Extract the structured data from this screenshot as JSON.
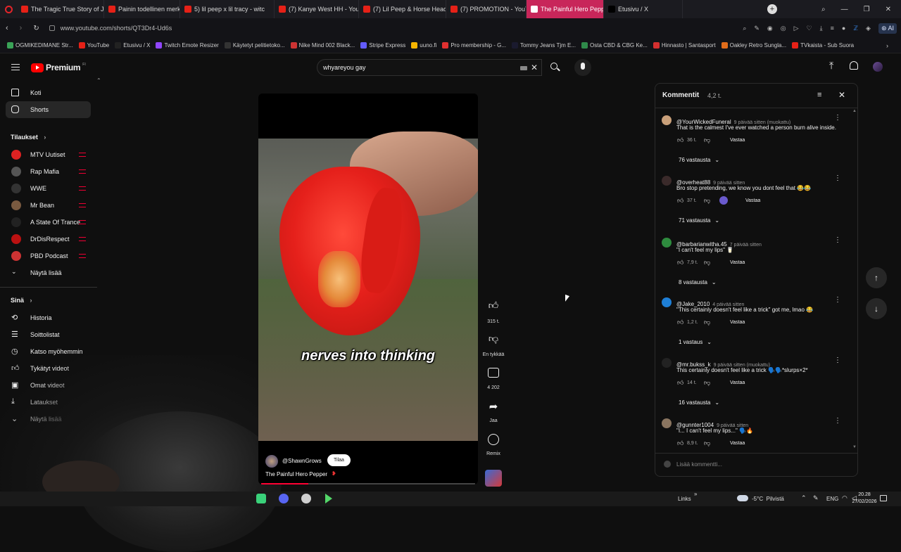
{
  "browser": {
    "tabs": [
      {
        "label": "The Tragic True Story of Ju",
        "color": "#e62117"
      },
      {
        "label": "Painin todellinen merkity",
        "color": "#e62117"
      },
      {
        "label": "5) lil peep x lil tracy - witc",
        "color": "#e62117"
      },
      {
        "label": "(7) Kanye West HH - YouT",
        "color": "#e62117"
      },
      {
        "label": "(7) Lil Peep & Horse Head",
        "color": "#e62117"
      },
      {
        "label": "(7) PROMOTION - YouTub",
        "color": "#e62117"
      },
      {
        "label": "The Painful Hero Pepp",
        "color": "#ffffff"
      },
      {
        "label": "Etusivu / X",
        "color": "#000000"
      }
    ],
    "url": "www.youtube.com/shorts/QT3Dr4-Ud6s",
    "addr_right_label": "AI",
    "bookmarks": [
      {
        "label": "OGMIKEDIMANE Str...",
        "color": "#3aa357"
      },
      {
        "label": "YouTube",
        "color": "#e62117"
      },
      {
        "label": "Etusivu / X",
        "color": "#222222"
      },
      {
        "label": "Twitch Emote Resizer",
        "color": "#9146ff"
      },
      {
        "label": "Käytetyt pelitietoko...",
        "color": "#333333"
      },
      {
        "label": "Nike Mind 002 Black...",
        "color": "#cc3333"
      },
      {
        "label": "Stripe Express",
        "color": "#635bff"
      },
      {
        "label": "uuno.fi",
        "color": "#f5b400"
      },
      {
        "label": "Pro membership - G...",
        "color": "#e03030"
      },
      {
        "label": "Tommy Jeans Tjm E...",
        "color": "#1a1a2e"
      },
      {
        "label": "Osta CBD & CBG Ke...",
        "color": "#2f8a4a"
      },
      {
        "label": "Hinnasto | Santasport",
        "color": "#d32f2f"
      },
      {
        "label": "Oakley Retro Sungla...",
        "color": "#e06c1a"
      },
      {
        "label": "TVkaista - Sub Suora",
        "color": "#e62117"
      }
    ]
  },
  "yt_header": {
    "logo_text": "Premium",
    "logo_sup": "FI",
    "search_value": "whyareyou gay"
  },
  "sidebar": {
    "top": [
      {
        "label": "Koti",
        "icon": "home-icon"
      },
      {
        "label": "Shorts",
        "icon": "shorts-icon"
      }
    ],
    "subs_heading": "Tilaukset",
    "subs": [
      {
        "label": "MTV Uutiset",
        "color": "#d22"
      },
      {
        "label": "Rap Mafia",
        "color": "#555"
      },
      {
        "label": "WWE",
        "color": "#333"
      },
      {
        "label": "Mr Bean",
        "color": "#7a5a40"
      },
      {
        "label": "A State Of Trance",
        "color": "#222"
      },
      {
        "label": "DrDisRespect",
        "color": "#b11"
      },
      {
        "label": "PBD Podcast",
        "color": "#c33"
      }
    ],
    "show_more": "Näytä lisää",
    "you_heading": "Sinä",
    "you": [
      {
        "label": "Historia",
        "icon": "history-icon"
      },
      {
        "label": "Soittolistat",
        "icon": "playlists-icon"
      },
      {
        "label": "Katso myöhemmin",
        "icon": "watch-later-icon"
      },
      {
        "label": "Tykätyt videot",
        "icon": "like-icon"
      },
      {
        "label": "Omat videot",
        "icon": "your-videos-icon"
      },
      {
        "label": "Lataukset",
        "icon": "downloads-icon"
      },
      {
        "label": "Näytä lisää",
        "icon": "chevron-down-icon"
      }
    ]
  },
  "short": {
    "caption": "nerves into thinking",
    "channel": "@ShawnGrows",
    "subscribe": "Tilaa",
    "title": "The Painful Hero Pepper",
    "like_count": "315 t.",
    "dislike_label": "En tykkää",
    "comment_count": "4 202",
    "share_label": "Jaa",
    "remix_label": "Remix"
  },
  "comments": {
    "heading": "Kommentit",
    "count": "4,2 t.",
    "add_placeholder": "Lisää kommentti...",
    "reply_label": "Vastaa",
    "items": [
      {
        "author": "@YourWickedFuneral",
        "time": "9 päivää sitten (muokattu)",
        "text": "That is the calmest I've ever watched a person burn alive inside.",
        "likes": "36 t.",
        "replies": "76 vastausta",
        "avatar": "#c9a07a"
      },
      {
        "author": "@overheat88",
        "time": "9 päivää sitten",
        "text": "Bro stop pretending, we know you dont feel that 😂😂",
        "likes": "37 t.",
        "replies": "71 vastausta",
        "avatar": "#3a2a2a"
      },
      {
        "author": "@barbarianwitha.45",
        "time": "7 päivää sitten",
        "text": "\"I can't feel my lips\" 🥛",
        "likes": "7,9 t.",
        "replies": "8 vastausta",
        "avatar": "#2e8b3e"
      },
      {
        "author": "@Jake_2010",
        "time": "4 päivää sitten",
        "text": "\"This certainly doesn't feel like a trick\" got me, lmao 😂",
        "likes": "1,2 t.",
        "replies": "1 vastaus",
        "avatar": "#1e7fd6"
      },
      {
        "author": "@mr.bukss_k",
        "time": "9 päivää sitten (muokattu)",
        "text": "This certainly doesn't feel like a trick 🗣️🗣️*slurps×2*",
        "likes": "14 t.",
        "replies": "16 vastausta",
        "avatar": "#222222"
      },
      {
        "author": "@gunnter1004",
        "time": "9 päivää sitten",
        "text": "\"I... I can't feel my lips...\" 🗣️🔥",
        "likes": "8,9 t.",
        "replies": "",
        "avatar": "#8a7560"
      }
    ]
  },
  "taskbar": {
    "links_label": "Links",
    "weather": "-5°C  Pilvistä",
    "lang": "ENG",
    "time": "20.28",
    "date": "27/02/2026"
  }
}
